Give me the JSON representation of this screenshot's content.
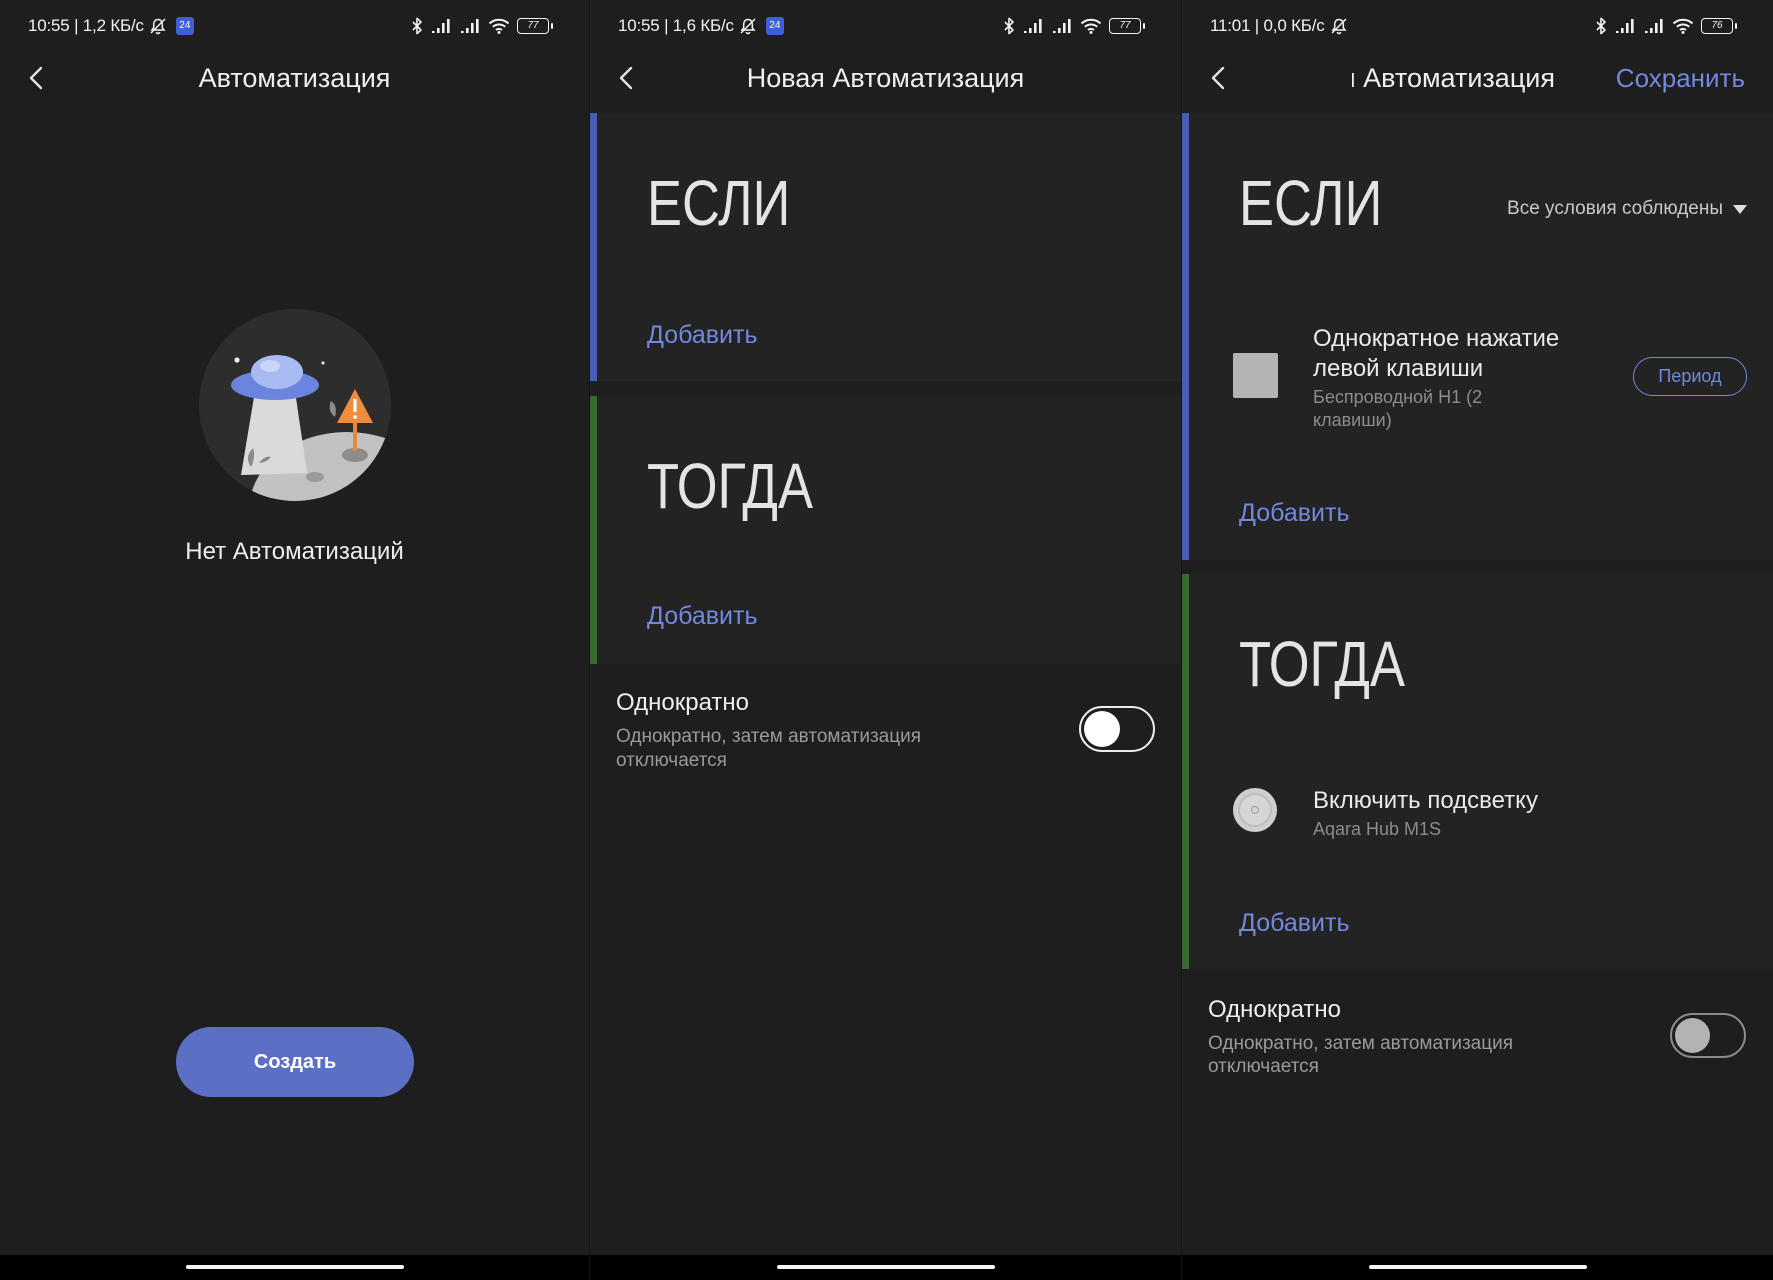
{
  "theme": {
    "accent": "#7189df",
    "if_bar": "#4a5db6",
    "then_bar": "#386a30",
    "primary_button": "#5b6fc5"
  },
  "status_icons": [
    "bell-off-icon",
    "bluetooth-icon",
    "signal-icon",
    "signal-icon",
    "wifi-icon",
    "battery-icon"
  ],
  "screens": {
    "list": {
      "status": {
        "text": "10:55 | 1,2 КБ/с",
        "badge": "24",
        "battery": "77"
      },
      "title": "Автоматизация",
      "empty_text": "Нет Автоматизаций",
      "create_label": "Создать"
    },
    "new": {
      "status": {
        "text": "10:55 | 1,6 КБ/с",
        "badge": "24",
        "battery": "77"
      },
      "title": "Новая Автоматизация",
      "if_block": {
        "heading": "ЕСЛИ",
        "add_label": "Добавить"
      },
      "then_block": {
        "heading": "ТОГДА",
        "add_label": "Добавить"
      },
      "once": {
        "title": "Однократно",
        "description": "Однократно, затем автоматизация отключается",
        "enabled": false
      }
    },
    "edit": {
      "status": {
        "text": "11:01 | 0,0 КБ/с",
        "battery": "76"
      },
      "title": "я Автоматизация",
      "save_label": "Сохранить",
      "if_block": {
        "heading": "ЕСЛИ",
        "condition_mode": "Все условия соблюдены",
        "conditions": [
          {
            "name": "Однократное нажатие левой клавиши",
            "device": "Беспроводной H1 (2 клавиши)",
            "period_label": "Период"
          }
        ],
        "add_label": "Добавить"
      },
      "then_block": {
        "heading": "ТОГДА",
        "actions": [
          {
            "name": "Включить подсветку",
            "device": "Aqara Hub M1S"
          }
        ],
        "add_label": "Добавить"
      },
      "once": {
        "title": "Однократно",
        "description": "Однократно, затем автоматизация отключается",
        "enabled": false
      }
    }
  }
}
